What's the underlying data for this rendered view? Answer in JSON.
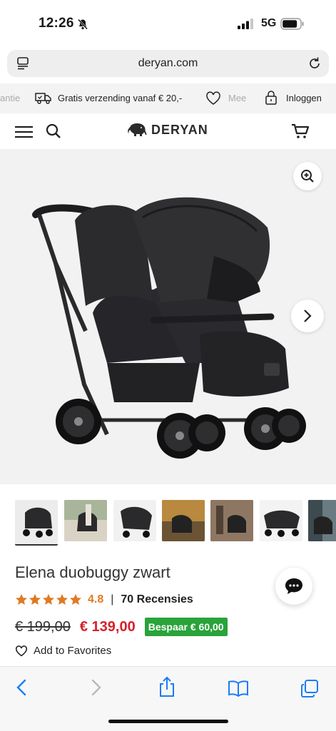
{
  "status_bar": {
    "time": "12:26",
    "network": "5G"
  },
  "browser": {
    "url": "deryan.com"
  },
  "usp_bar": {
    "items": [
      "antie",
      "Gratis verzending vanaf € 20,-",
      "Mee",
      "Inloggen"
    ]
  },
  "header": {
    "logo_text": "DERYAN"
  },
  "product": {
    "title": "Elena duobuggy zwart",
    "rating": "4.8",
    "separator": "|",
    "reviews": "70 Recensies",
    "old_price": "€ 199,00",
    "new_price": "€ 139,00",
    "save_label": "Bespaar  € 60,00",
    "favorite_label": "Add to Favorites",
    "stars": 5
  },
  "colors": {
    "price_red": "#d5202a",
    "save_green": "#29a33a",
    "star_orange": "#e07a22",
    "ios_blue": "#1a7cf5"
  }
}
